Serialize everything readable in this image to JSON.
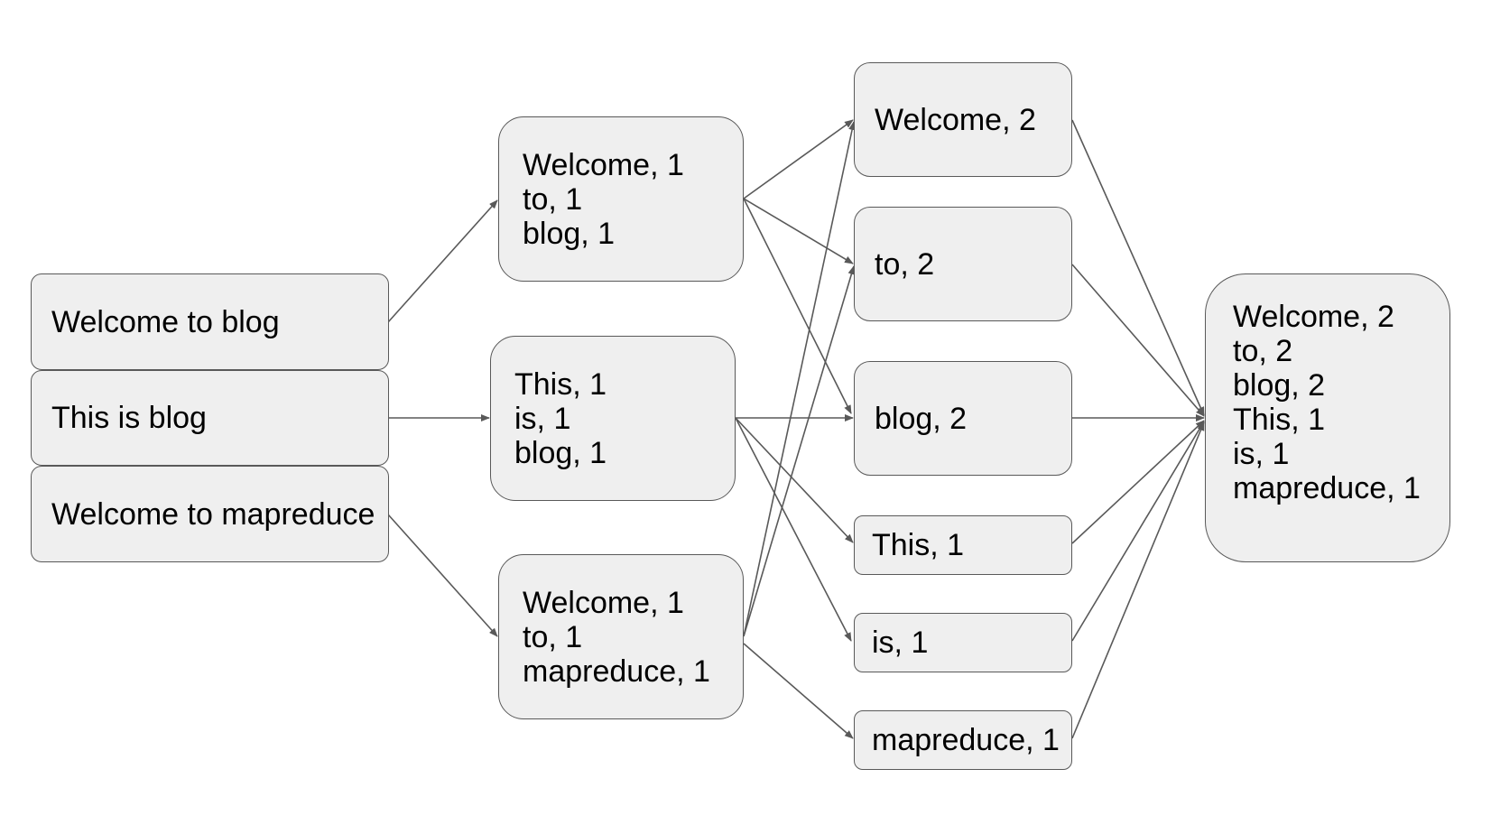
{
  "colors": {
    "box_fill": "#efefef",
    "box_border": "#595959",
    "arrow": "#595959"
  },
  "input": {
    "lines": [
      "Welcome to blog",
      "This is blog",
      "Welcome to mapreduce"
    ]
  },
  "map": [
    {
      "lines": [
        "Welcome, 1",
        "to, 1",
        "blog, 1"
      ]
    },
    {
      "lines": [
        "This, 1",
        "is, 1",
        "blog, 1"
      ]
    },
    {
      "lines": [
        "Welcome, 1",
        "to, 1",
        "mapreduce, 1"
      ]
    }
  ],
  "reduce": [
    {
      "label": "Welcome, 2"
    },
    {
      "label": "to, 2"
    },
    {
      "label": "blog, 2"
    },
    {
      "label": "This, 1"
    },
    {
      "label": "is, 1"
    },
    {
      "label": "mapreduce, 1"
    }
  ],
  "output": {
    "lines": [
      "Welcome, 2",
      "to, 2",
      "blog, 2",
      "This, 1",
      "is, 1",
      "mapreduce, 1"
    ]
  }
}
